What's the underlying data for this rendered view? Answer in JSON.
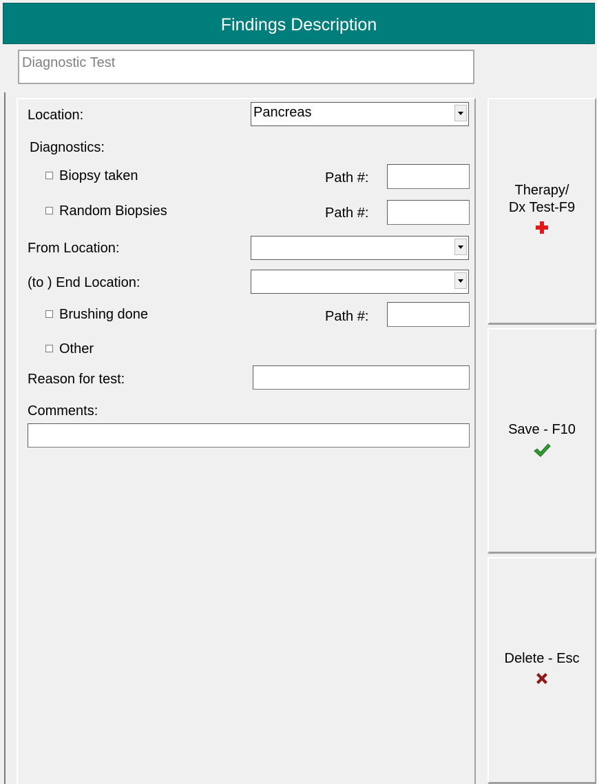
{
  "window": {
    "title": "Findings Description"
  },
  "header": {
    "field_value": "Diagnostic Test"
  },
  "form": {
    "location_label": "Location:",
    "location_value": "Pancreas",
    "diagnostics_label": "Diagnostics:",
    "biopsy_taken_label": "Biopsy taken",
    "random_biopsies_label": "Random Biopsies",
    "path_label": "Path #:",
    "from_location_label": "From Location:",
    "from_location_value": "",
    "end_location_label": "(to ) End Location:",
    "end_location_value": "",
    "brushing_done_label": "Brushing done",
    "other_label": "Other",
    "reason_label": "Reason for test:",
    "reason_value": "",
    "comments_label": "Comments:",
    "comments_value": ""
  },
  "buttons": {
    "therapy_label": "Therapy/\nDx Test-F9",
    "save_label": "Save - F10",
    "delete_label": "Delete - Esc"
  },
  "colors": {
    "title_bar": "#007e7b",
    "plus_icon": "#e01a1a",
    "check_icon": "#2e9e2e",
    "x_icon": "#8b1a1a"
  }
}
